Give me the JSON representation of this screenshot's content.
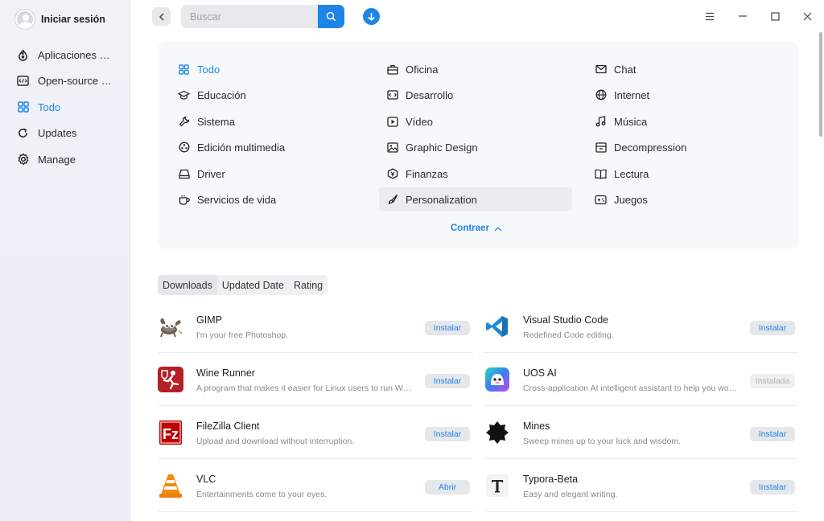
{
  "user": {
    "name": "Iniciar sesión"
  },
  "sidebar": {
    "items": [
      {
        "label": "Aplicaciones …",
        "icon": "fire-icon"
      },
      {
        "label": "Open-source …",
        "icon": "code-icon"
      },
      {
        "label": "Todo",
        "icon": "grid-icon",
        "active": true
      },
      {
        "label": "Updates",
        "icon": "updates-icon"
      },
      {
        "label": "Manage",
        "icon": "gear-icon"
      }
    ]
  },
  "search": {
    "placeholder": "Buscar"
  },
  "categories": {
    "items": [
      {
        "label": "Todo",
        "active": true
      },
      {
        "label": "Oficina"
      },
      {
        "label": "Chat"
      },
      {
        "label": "Educación"
      },
      {
        "label": "Desarrollo"
      },
      {
        "label": "Internet"
      },
      {
        "label": "Sistema"
      },
      {
        "label": "Vídeo"
      },
      {
        "label": "Música"
      },
      {
        "label": "Edición multimedia"
      },
      {
        "label": "Graphic Design"
      },
      {
        "label": "Decompression"
      },
      {
        "label": "Driver"
      },
      {
        "label": "Finanzas"
      },
      {
        "label": "Lectura"
      },
      {
        "label": "Servicios de vida"
      },
      {
        "label": "Personalization",
        "hover": true
      },
      {
        "label": "Juegos"
      }
    ],
    "collapse_label": "Contraer"
  },
  "sort_tabs": [
    "Downloads",
    "Updated Date",
    "Rating"
  ],
  "apps": [
    {
      "name": "GIMP",
      "desc": "I'm your free Photoshop.",
      "action": "Instalar"
    },
    {
      "name": "Visual Studio Code",
      "desc": "Redefined Code editing.",
      "action": "Instalar"
    },
    {
      "name": "Wine Runner",
      "desc": "A program that makes it easier for Linux users to run Win…",
      "action": "Instalar"
    },
    {
      "name": "UOS AI",
      "desc": "Cross-application AI intelligent assistant to help you wor…",
      "action": "Instalada",
      "disabled": true
    },
    {
      "name": "FileZilla Client",
      "desc": "Upload and download without interruption.",
      "action": "Instalar"
    },
    {
      "name": "Mines",
      "desc": "Sweep mines up to your luck and wisdom.",
      "action": "Instalar"
    },
    {
      "name": "VLC",
      "desc": "Entertainments come to your eyes.",
      "action": "Abrir"
    },
    {
      "name": "Typora-Beta",
      "desc": "Easy and elegant writing.",
      "action": "Instalar"
    }
  ],
  "colors": {
    "accent": "#1e85e6",
    "sidebar_bg": "#f0f1f7",
    "panel_bg": "#f7f8fa"
  }
}
